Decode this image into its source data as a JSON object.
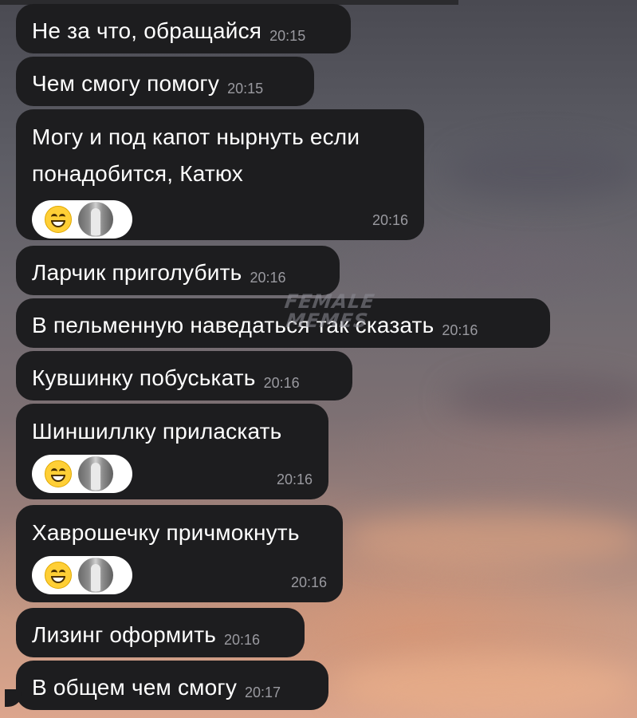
{
  "messages": [
    {
      "text": "Не за что, обращайся",
      "time": "20:15"
    },
    {
      "text": "Чем смогу помогу",
      "time": "20:15"
    },
    {
      "text_lines": [
        "Могу и под капот нырнуть если",
        "понадобится, Катюх"
      ],
      "time": "20:16",
      "reactions": [
        "grinning-face-emoji",
        "user-avatar"
      ]
    },
    {
      "text": "Ларчик приголубить",
      "time": "20:16"
    },
    {
      "text": "В пельменную наведаться так сказать",
      "time": "20:16"
    },
    {
      "text": "Кувшинку побуськать",
      "time": "20:16"
    },
    {
      "text_lines": [
        "Шиншиллку приласкать"
      ],
      "time": "20:16",
      "reactions": [
        "grinning-face-emoji",
        "user-avatar"
      ]
    },
    {
      "text_lines": [
        "Хаврошечку причмокнуть"
      ],
      "time": "20:16",
      "reactions": [
        "grinning-face-emoji",
        "user-avatar"
      ]
    },
    {
      "text": "Лизинг оформить",
      "time": "20:16"
    },
    {
      "text": "В общем чем смогу",
      "time": "20:17"
    }
  ],
  "watermark": {
    "line1": "FEMALE",
    "line2": "MEMES"
  },
  "colors": {
    "bubble": "#1d1d1f",
    "text": "#ffffff",
    "time": "#9a9aa0",
    "reaction_bg": "#ffffff"
  }
}
